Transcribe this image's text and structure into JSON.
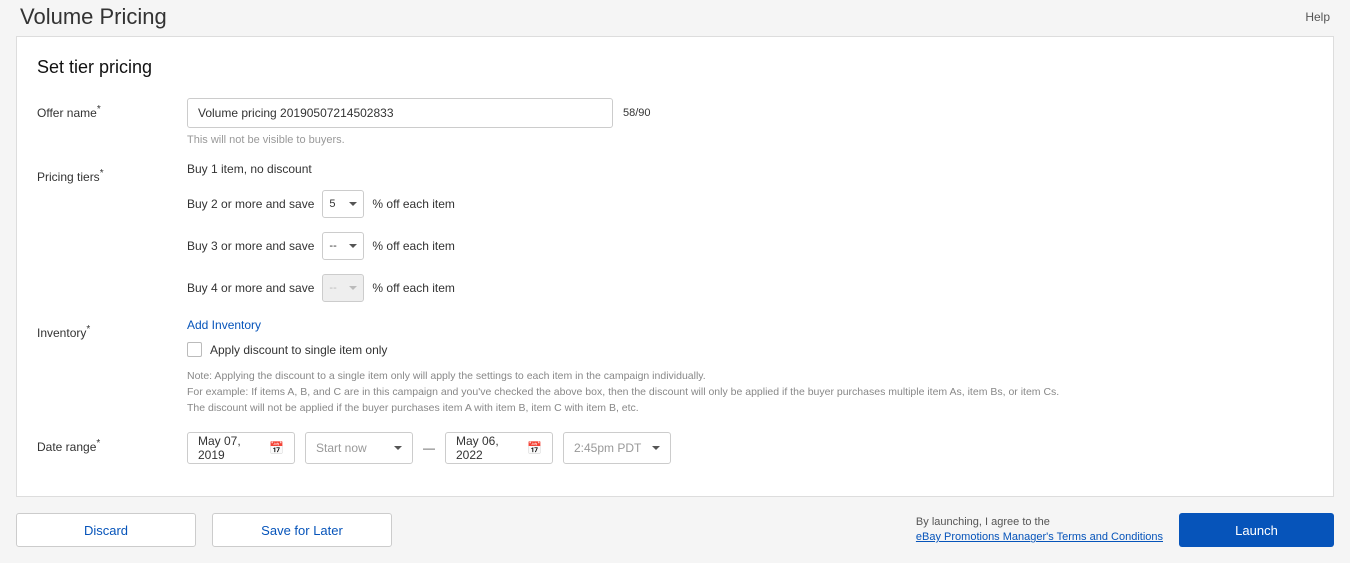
{
  "header": {
    "title": "Volume Pricing",
    "help": "Help"
  },
  "panel": {
    "title": "Set tier pricing"
  },
  "offerName": {
    "label": "Offer name",
    "value": "Volume pricing 20190507214502833",
    "counter": "58/90",
    "hint": "This will not be visible to buyers."
  },
  "tiers": {
    "label": "Pricing tiers",
    "tier1": "Buy 1 item, no discount",
    "prefix2": "Buy 2 or more and save",
    "prefix3": "Buy 3 or more and save",
    "prefix4": "Buy 4 or more and save",
    "value2": "5",
    "value3": "--",
    "value4": "--",
    "suffix": "% off each item"
  },
  "inventory": {
    "label": "Inventory",
    "addLink": "Add Inventory",
    "checkboxLabel": "Apply discount to single item only",
    "noteLine1": "Note: Applying the discount to a single item only will apply the settings to each item in the campaign individually.",
    "noteLine2": "For example: If items A, B, and C are in this campaign and you've checked the above box, then the discount will only be applied if the buyer purchases multiple item As, item Bs, or item Cs.",
    "noteLine3": "The discount will not be applied if the buyer purchases item A with item B, item C with item B, etc."
  },
  "dateRange": {
    "label": "Date range",
    "startDate": "May 07, 2019",
    "startTimePlaceholder": "Start now",
    "endDate": "May 06, 2022",
    "endTimePlaceholder": "2:45pm PDT"
  },
  "footer": {
    "discard": "Discard",
    "saveForLater": "Save for Later",
    "agree": "By launching, I agree to the",
    "termsLink": "eBay Promotions Manager's Terms and Conditions",
    "launch": "Launch"
  }
}
